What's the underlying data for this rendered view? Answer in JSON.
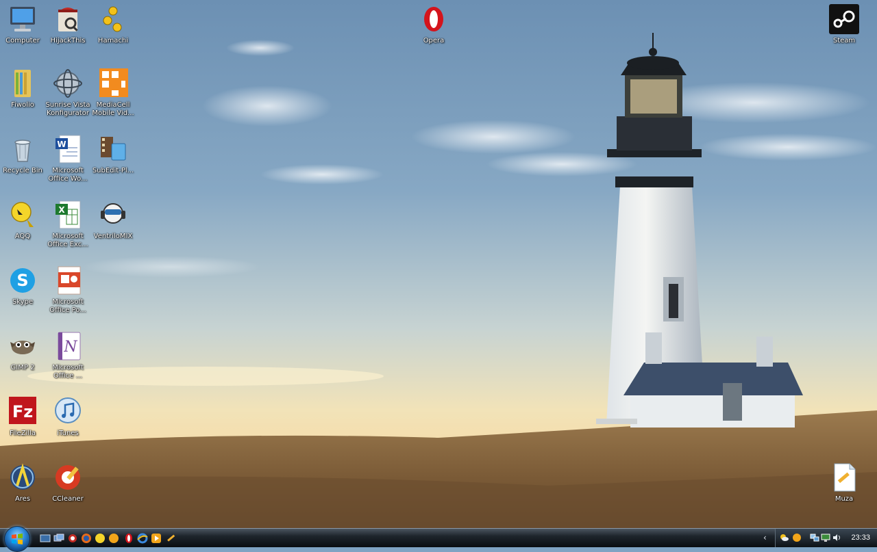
{
  "desktop": {
    "icons": [
      {
        "id": "computer",
        "label": "Computer",
        "icon": "computer-icon"
      },
      {
        "id": "hijackthis",
        "label": "HijackThis",
        "icon": "hijackthis-icon"
      },
      {
        "id": "hamachi",
        "label": "Hamachi",
        "icon": "hamachi-icon"
      },
      {
        "id": "opera",
        "label": "Opera",
        "icon": "opera-icon"
      },
      {
        "id": "steam",
        "label": "Steam",
        "icon": "steam-icon"
      },
      {
        "id": "fiwolio",
        "label": "Fiwolio",
        "icon": "folder-icon"
      },
      {
        "id": "sunrise",
        "label": "Sunrise Vista Konfigurator",
        "icon": "sunrise-icon"
      },
      {
        "id": "mediacell",
        "label": "MediaCell Mobile Vid...",
        "icon": "mediacell-icon"
      },
      {
        "id": "recycle",
        "label": "Recycle Bin",
        "icon": "recycle-bin-icon"
      },
      {
        "id": "word",
        "label": "Microsoft Office Wo...",
        "icon": "word-icon"
      },
      {
        "id": "subedit",
        "label": "SubEdit-Pl...",
        "icon": "subedit-icon"
      },
      {
        "id": "aqq",
        "label": "AQQ",
        "icon": "aqq-icon"
      },
      {
        "id": "excel",
        "label": "Microsoft Office Exc...",
        "icon": "excel-icon"
      },
      {
        "id": "ventrilo",
        "label": "VentriloMIX",
        "icon": "ventrilo-icon"
      },
      {
        "id": "skype",
        "label": "Skype",
        "icon": "skype-icon"
      },
      {
        "id": "powerpoint",
        "label": "Microsoft Office Po...",
        "icon": "powerpoint-icon"
      },
      {
        "id": "gimp",
        "label": "GIMP 2",
        "icon": "gimp-icon"
      },
      {
        "id": "onenote",
        "label": "Microsoft Office ...",
        "icon": "onenote-icon"
      },
      {
        "id": "filezilla",
        "label": "FileZilla",
        "icon": "filezilla-icon"
      },
      {
        "id": "itunes",
        "label": "iTunes",
        "icon": "itunes-icon"
      },
      {
        "id": "ares",
        "label": "Ares",
        "icon": "ares-icon"
      },
      {
        "id": "ccleaner",
        "label": "CCleaner",
        "icon": "ccleaner-icon"
      },
      {
        "id": "muza",
        "label": "Muza",
        "icon": "text-document-icon"
      }
    ]
  },
  "taskbar": {
    "start_button_icon": "windows-logo-icon",
    "quick_launch": [
      "show-desktop-icon",
      "switch-windows-icon",
      "hijackthis-icon",
      "firefox-icon",
      "aqq-icon",
      "opera-icon",
      "media-player-icon",
      "internet-explorer-icon",
      "winamp-icon",
      "notepad-icon"
    ],
    "tray": {
      "icons": [
        "weather-icon",
        "sun-icon",
        "network-icon",
        "monitor-icon",
        "volume-icon"
      ],
      "clock": "23:33"
    }
  },
  "colors": {
    "sky_top": "#6f93b5",
    "sky_horizon": "#f3e1b4",
    "grass": "#8a6a40",
    "taskbar": "#1e252c",
    "opera_red": "#d4141c"
  }
}
